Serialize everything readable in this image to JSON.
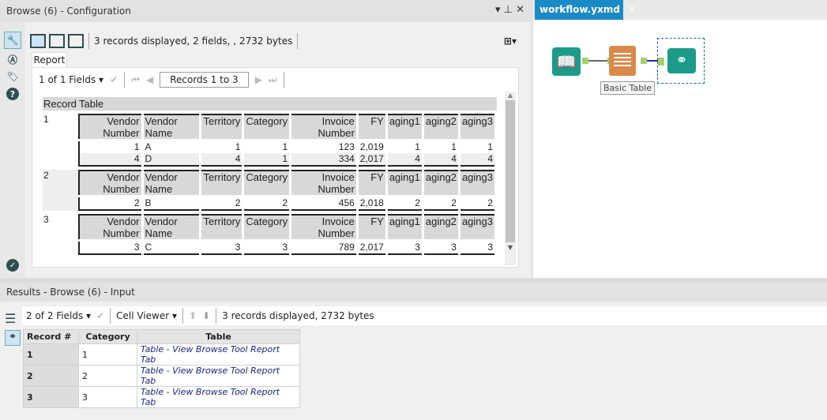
{
  "config_panel": {
    "title": "Browse (6) - Configuration",
    "status": "3 records displayed, 2 fields, , 2732 bytes",
    "tab": "Report",
    "fields_selector": "1 of 1 Fields",
    "records_box": "Records 1 to 3",
    "report_headers": [
      "Record",
      "Table"
    ],
    "columns": [
      [
        "Vendor",
        "Number"
      ],
      [
        "Vendor",
        "Name"
      ],
      [
        "Territory",
        ""
      ],
      [
        "Category",
        ""
      ],
      [
        "Invoice",
        "Number"
      ],
      [
        "FY",
        ""
      ],
      [
        "aging1",
        ""
      ],
      [
        "aging2",
        ""
      ],
      [
        "aging3",
        ""
      ]
    ],
    "records": [
      {
        "num": "1",
        "rows": [
          [
            "1",
            "A",
            "1",
            "1",
            "123",
            "2,019",
            "1",
            "1",
            "1"
          ],
          [
            "4",
            "D",
            "4",
            "1",
            "334",
            "2,017",
            "4",
            "4",
            "4"
          ]
        ]
      },
      {
        "num": "2",
        "rows": [
          [
            "2",
            "B",
            "2",
            "2",
            "456",
            "2,018",
            "2",
            "2",
            "2"
          ]
        ]
      },
      {
        "num": "3",
        "rows": [
          [
            "3",
            "C",
            "3",
            "3",
            "789",
            "2,017",
            "3",
            "3",
            "3"
          ]
        ]
      }
    ]
  },
  "workflow": {
    "tab": "workflow.yxmd",
    "tool_label": "Basic Table"
  },
  "results": {
    "title": "Results - Browse (6) - Input",
    "fields_selector": "2 of 2 Fields",
    "cell_viewer": "Cell Viewer",
    "status": "3 records displayed, 2732 bytes",
    "headers": [
      "Record #",
      "Category",
      "Table"
    ],
    "rows": [
      [
        "1",
        "1",
        "Table - View Browse Tool Report Tab"
      ],
      [
        "2",
        "2",
        "Table - View Browse Tool Report Tab"
      ],
      [
        "3",
        "3",
        "Table - View Browse Tool Report Tab"
      ]
    ]
  },
  "colors": {
    "accent": "#1a8ac6",
    "tool_green": "#1c9a8a",
    "tool_orange": "#d9894a"
  }
}
